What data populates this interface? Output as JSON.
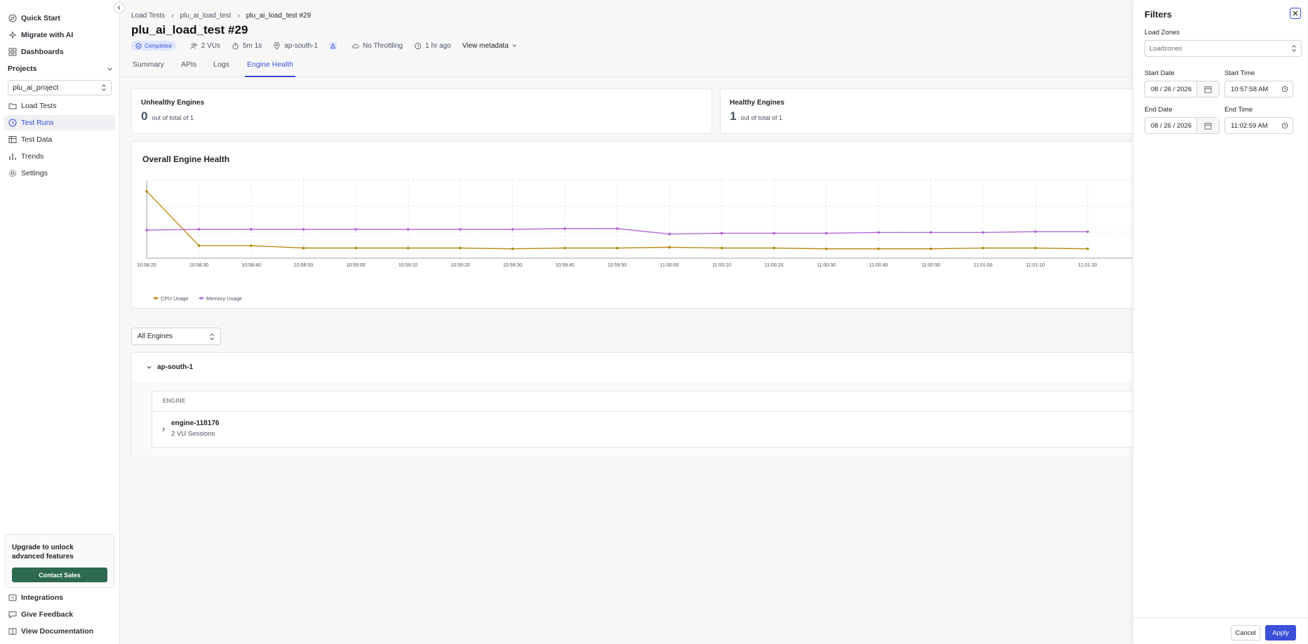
{
  "sidebar": {
    "top_items": [
      {
        "label": "Quick Start",
        "icon": "compass-icon"
      },
      {
        "label": "Migrate with AI",
        "icon": "sparkle-icon"
      },
      {
        "label": "Dashboards",
        "icon": "grid-icon"
      }
    ],
    "projects_label": "Projects",
    "project_selected": "plu_ai_project",
    "project_items": [
      {
        "label": "Load Tests",
        "icon": "folder-icon"
      },
      {
        "label": "Test Runs",
        "icon": "clock-run-icon",
        "active": true
      },
      {
        "label": "Test Data",
        "icon": "table-icon"
      },
      {
        "label": "Trends",
        "icon": "bar-chart-icon"
      },
      {
        "label": "Settings",
        "icon": "gear-icon"
      }
    ],
    "upgrade_text": "Upgrade to unlock advanced features",
    "contact_sales": "Contact Sales",
    "bottom_items": [
      {
        "label": "Integrations",
        "icon": "link-icon"
      },
      {
        "label": "Give Feedback",
        "icon": "chat-icon"
      },
      {
        "label": "View Documentation",
        "icon": "book-icon"
      }
    ]
  },
  "breadcrumb": [
    "Load Tests",
    "plu_ai_load_test",
    "plu_ai_load_test #29"
  ],
  "title": "plu_ai_load_test #29",
  "meta": {
    "status": "Completed",
    "vus": "2 VUs",
    "duration": "5m 1s",
    "region": "ap-south-1",
    "throttling": "No Throttling",
    "time_ago": "1 hr ago",
    "view_metadata": "View metadata"
  },
  "tabs": [
    "Summary",
    "APIs",
    "Logs",
    "Engine Health"
  ],
  "active_tab": "Engine Health",
  "stats": {
    "unhealthy_label": "Unhealthy Engines",
    "unhealthy_value": "0",
    "unhealthy_sub": "out of total of 1",
    "healthy_label": "Healthy Engines",
    "healthy_value": "1",
    "healthy_sub": "out of total of 1"
  },
  "chart_data": {
    "type": "line",
    "title": "Overall Engine Health",
    "x": [
      "10:58:20",
      "10:58:30",
      "10:58:40",
      "10:58:50",
      "10:59:00",
      "10:59:10",
      "10:59:20",
      "10:59:30",
      "10:59:40",
      "10:59:50",
      "11:00:00",
      "11:00:10",
      "11:00:20",
      "11:00:30",
      "11:00:40",
      "11:00:50",
      "11:01:00",
      "11:01:10",
      "11:01:20"
    ],
    "series": [
      {
        "name": "CPU Usage",
        "color": "#b8860b",
        "values": [
          0.86,
          0.16,
          0.16,
          0.13,
          0.13,
          0.13,
          0.13,
          0.12,
          0.13,
          0.13,
          0.14,
          0.13,
          0.13,
          0.12,
          0.12,
          0.12,
          0.13,
          0.13,
          0.12
        ]
      },
      {
        "name": "Memory Usage",
        "color": "#b05fd6",
        "values": [
          0.36,
          0.37,
          0.37,
          0.37,
          0.37,
          0.37,
          0.37,
          0.37,
          0.38,
          0.38,
          0.31,
          0.32,
          0.32,
          0.32,
          0.33,
          0.33,
          0.33,
          0.34,
          0.34
        ]
      }
    ],
    "ylim": [
      0,
      1
    ],
    "grid": true,
    "legend": "bottom-left"
  },
  "engines_filter": "All Engines",
  "region_group": "ap-south-1",
  "engine_table": {
    "header": "ENGINE",
    "rows": [
      {
        "name": "engine-118176",
        "sessions": "2 VU Sessions"
      }
    ]
  },
  "filters": {
    "title": "Filters",
    "load_zones_label": "Load Zones",
    "load_zones_placeholder": "Loadzones",
    "start_date_label": "Start Date",
    "start_date": "08 / 26 / 2026",
    "start_time_label": "Start Time",
    "start_time": "10:57:58 AM",
    "end_date_label": "End Date",
    "end_date": "08 / 26 / 2026",
    "end_time_label": "End Time",
    "end_time": "11:02:59 AM",
    "cancel": "Cancel",
    "apply": "Apply"
  }
}
